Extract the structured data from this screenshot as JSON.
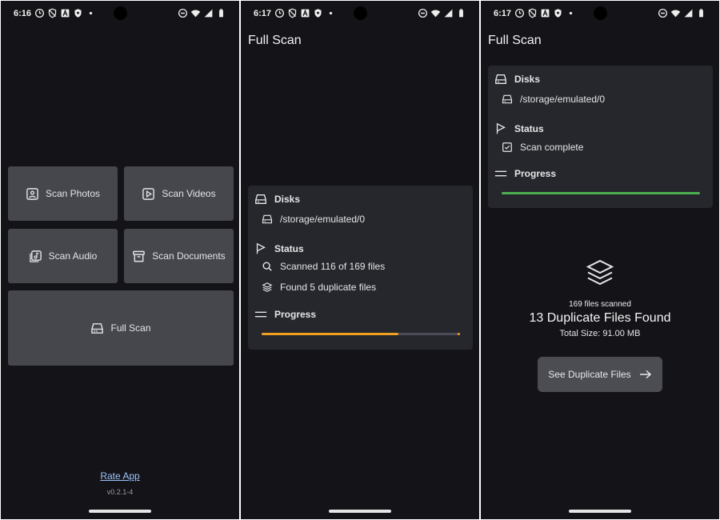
{
  "screen1": {
    "status_time": "6:16",
    "tiles": {
      "scan_photos": "Scan Photos",
      "scan_videos": "Scan Videos",
      "scan_audio": "Scan Audio",
      "scan_documents": "Scan Documents",
      "full_scan": "Full Scan"
    },
    "rate_app": "Rate App",
    "version": "v0.2.1-4"
  },
  "screen2": {
    "status_time": "6:17",
    "title": "Full Scan",
    "disks_label": "Disks",
    "disk_path": "/storage/emulated/0",
    "status_label": "Status",
    "status_scanned": "Scanned 116 of 169 files",
    "status_found": "Found 5 duplicate files",
    "progress_label": "Progress",
    "progress_fraction": 0.69
  },
  "screen3": {
    "status_time": "6:17",
    "title": "Full Scan",
    "disks_label": "Disks",
    "disk_path": "/storage/emulated/0",
    "status_label": "Status",
    "status_complete": "Scan complete",
    "progress_label": "Progress",
    "progress_fraction": 1.0,
    "files_scanned": "169 files scanned",
    "duplicates_found": "13 Duplicate Files Found",
    "total_size": "Total Size: 91.00 MB",
    "see_button": "See Duplicate Files"
  },
  "colors": {
    "background": "#141418",
    "tile": "#45474d",
    "card": "#26272c",
    "progress_running": "#f0a020",
    "progress_track": "#4a4d57",
    "progress_done": "#4caf50",
    "link": "#9cc4ff"
  },
  "icons": [
    "photo-icon",
    "video-icon",
    "audio-icon",
    "archive-icon",
    "drive-icon",
    "flag-icon",
    "search-icon",
    "layers-icon",
    "check-box-icon",
    "menu-lines-icon",
    "arrow-right-icon"
  ]
}
